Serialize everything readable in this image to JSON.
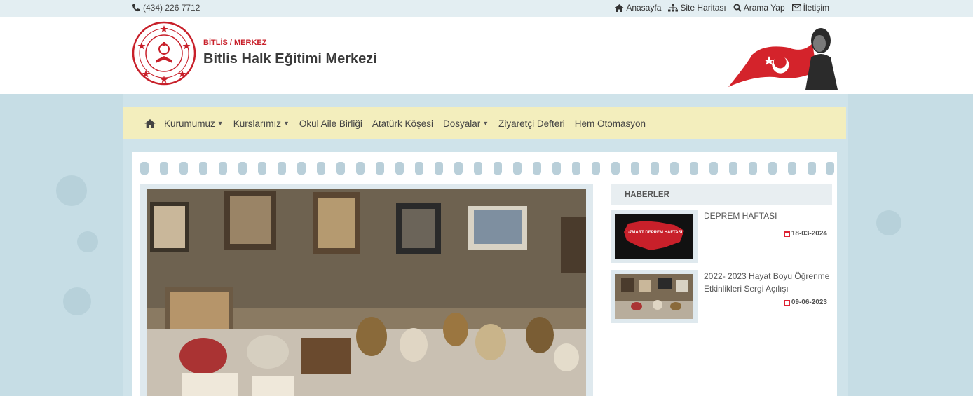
{
  "topbar": {
    "phone": "(434) 226 7712",
    "links": [
      {
        "label": "Anasayfa",
        "icon": "home-icon"
      },
      {
        "label": "Site Haritası",
        "icon": "sitemap-icon"
      },
      {
        "label": "Arama Yap",
        "icon": "search-icon"
      },
      {
        "label": "İletişim",
        "icon": "envelope-icon"
      }
    ]
  },
  "header": {
    "city": "BİTLİS / MERKEZ",
    "title": "Bitlis Halk Eğitimi Merkezi"
  },
  "nav": {
    "items": [
      {
        "label": "Kurumumuz",
        "dropdown": true
      },
      {
        "label": "Kurslarımız",
        "dropdown": true
      },
      {
        "label": "Okul Aile Birliği",
        "dropdown": false
      },
      {
        "label": "Atatürk Köşesi",
        "dropdown": false
      },
      {
        "label": "Dosyalar",
        "dropdown": true
      },
      {
        "label": "Ziyaretçi Defteri",
        "dropdown": false
      },
      {
        "label": "Hem Otomasyon",
        "dropdown": false
      }
    ]
  },
  "news": {
    "heading": "HABERLER",
    "items": [
      {
        "title": "DEPREM HAFTASI",
        "date": "18-03-2024",
        "thumb_text": "1-7MART DEPREM HAFTASI"
      },
      {
        "title": "2022- 2023 Hayat Boyu Öğrenme Etkinlikleri Sergi Açılışı",
        "date": "09-06-2023"
      }
    ]
  },
  "colors": {
    "accent_red": "#c8202a",
    "nav_bg": "#f3eebd",
    "page_bg": "#cfe3ea"
  }
}
